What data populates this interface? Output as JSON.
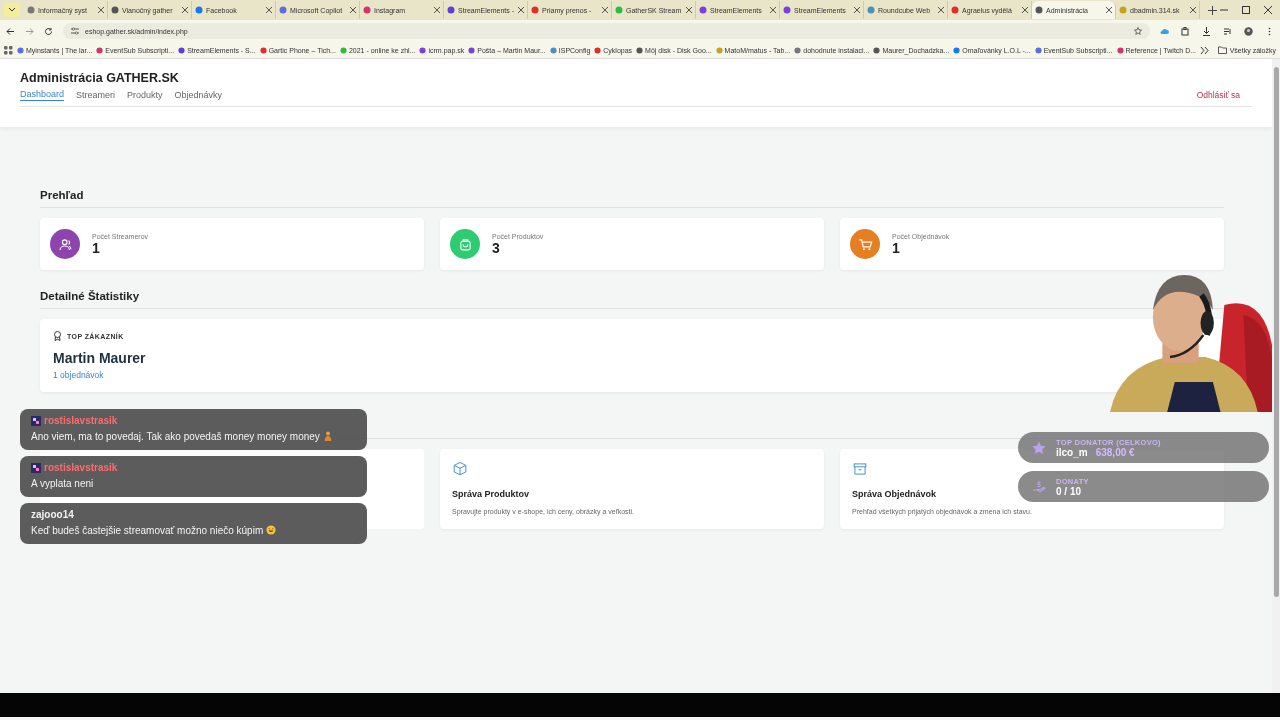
{
  "browser": {
    "tabs": [
      {
        "title": "Informačný syst",
        "selected": false
      },
      {
        "title": "Vianočný gather",
        "selected": false
      },
      {
        "title": "Facebook",
        "selected": false
      },
      {
        "title": "Microsoft Copilot",
        "selected": false
      },
      {
        "title": "Instagram",
        "selected": false
      },
      {
        "title": "StreamElements -",
        "selected": false
      },
      {
        "title": "Priamy prenos -",
        "selected": false
      },
      {
        "title": "GatherSK Stream",
        "selected": false
      },
      {
        "title": "StreamElements",
        "selected": false
      },
      {
        "title": "StreamElements",
        "selected": false
      },
      {
        "title": "Roundcube Web",
        "selected": false
      },
      {
        "title": "Agraelus vydělá",
        "selected": false
      },
      {
        "title": "Administrácia",
        "selected": true
      },
      {
        "title": "dbadmin.314.sk",
        "selected": false
      }
    ],
    "address": "eshop.gather.sk/admin/index.php",
    "bookmarks": [
      "Myinstants | The lar...",
      "EventSub Subscripti...",
      "StreamElements - S...",
      "Gartic Phone – Tich...",
      "2021 - online ke zhl...",
      "icrm.pap.sk",
      "Pošta – Martin Maur...",
      "ISPConfig",
      "Cyklopas",
      "Môj disk - Disk Goo...",
      "MatoM/matus - Tab...",
      "dohodnute instalaci...",
      "Maurer_Dochadzka...",
      "Omaľovánky L.O.L -...",
      "EventSub Subscripti...",
      "Reference | Twitch D..."
    ],
    "all_bookmarks": "Všetky záložky"
  },
  "page": {
    "title": "Administrácia GATHER.SK",
    "nav": [
      {
        "label": "Dashboard",
        "selected": true
      },
      {
        "label": "Streameri",
        "selected": false
      },
      {
        "label": "Produkty",
        "selected": false
      },
      {
        "label": "Objednávky",
        "selected": false
      }
    ],
    "logout": "Odhlásiť sa",
    "overview": {
      "heading": "Prehľad",
      "stats": [
        {
          "kind": "streamers",
          "label": "Počet Streamerov",
          "value": "1",
          "color": "#8e44ad"
        },
        {
          "kind": "products",
          "label": "Počet Produktov",
          "value": "3",
          "color": "#2ecc71"
        },
        {
          "kind": "orders",
          "label": "Počet Objednávok",
          "value": "1",
          "color": "#e67e22"
        }
      ]
    },
    "details": {
      "heading": "Detailné Štatistiky",
      "top_customer": {
        "label": "TOP ZÁKAZNÍK",
        "name": "Martin Maurer",
        "orders": "1 objednávok"
      }
    },
    "menu": {
      "items": [
        {
          "kind": "products",
          "title": "Správa Produktov",
          "description": "Spravujte produkty v e-shope, ich ceny, obrázky a veľkosti."
        },
        {
          "kind": "orders",
          "title": "Správa Objednávok",
          "description": "Prehľad všetkých prijatých objednávok a zmena ich stavu."
        }
      ]
    }
  },
  "stream_overlay": {
    "chat": [
      {
        "user": "rostislavstrasik",
        "badge": true,
        "color": "#ff6b6b",
        "text": "Ano viem, ma to povedaj. Tak ako povedaš money money money",
        "kind": "person-emoji"
      },
      {
        "user": "rostislavstrasik",
        "badge": true,
        "color": "#ff6b6b",
        "text": "A vyplata neni",
        "kind": "plain"
      },
      {
        "user": "zajooo14",
        "badge": false,
        "color": "#f2f2f2",
        "text": "Keď budeš častejšie streamovať možno niečo kúpim",
        "kind": "laugh-emoji"
      }
    ],
    "donations": [
      {
        "kind": "top",
        "label": "TOP DONATOR (CELKOVO)",
        "value": "ilco_m",
        "amount": "638,00 €"
      },
      {
        "kind": "count",
        "label": "DONATY",
        "value": "0 / 10"
      }
    ]
  }
}
